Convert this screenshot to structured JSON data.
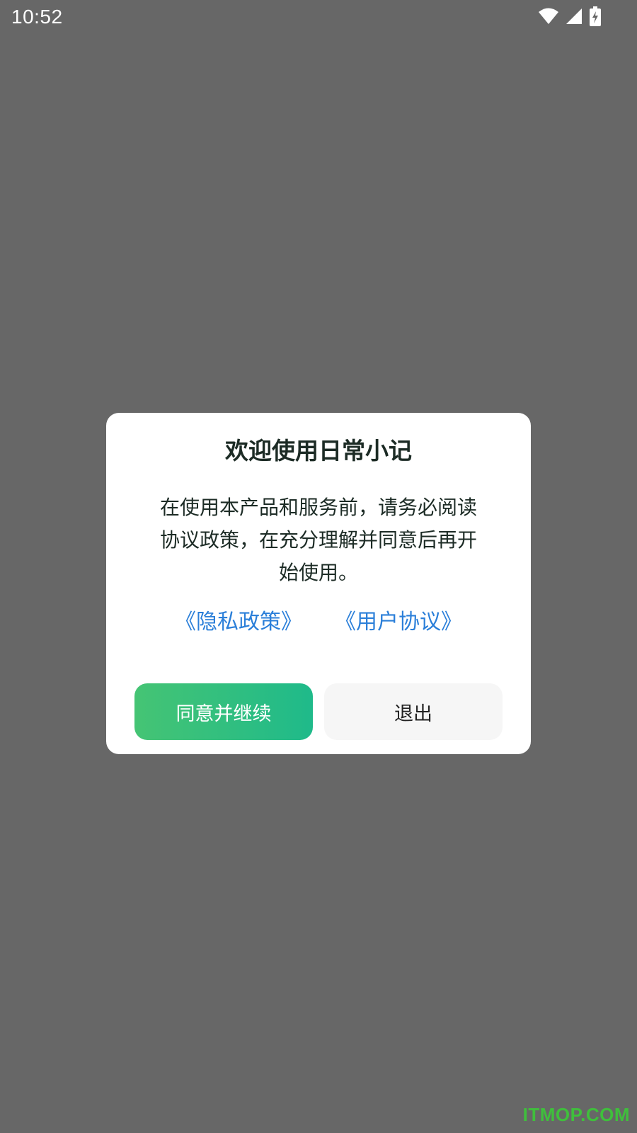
{
  "status_bar": {
    "time": "10:52",
    "icons": [
      "wifi-icon",
      "cellular-signal-icon",
      "battery-charging-icon"
    ]
  },
  "dialog": {
    "title": "欢迎使用日常小记",
    "body_lines": [
      "在使用本产品和服务前，请务必阅读",
      "协议政策，在充分理解并同意后再开",
      "始使用。"
    ],
    "links": {
      "privacy": "《隐私政策》",
      "user_agreement": "《用户协议》"
    },
    "buttons": {
      "agree": "同意并继续",
      "exit": "退出"
    }
  },
  "watermark": "ITMOP.COM",
  "colors": {
    "backdrop": "#676767",
    "dialog_bg": "#ffffff",
    "link": "#2b7fd9",
    "agree_gradient_start": "#45c474",
    "agree_gradient_end": "#1fba8a",
    "exit_bg": "#f6f6f6",
    "watermark": "#3fbf3c"
  }
}
